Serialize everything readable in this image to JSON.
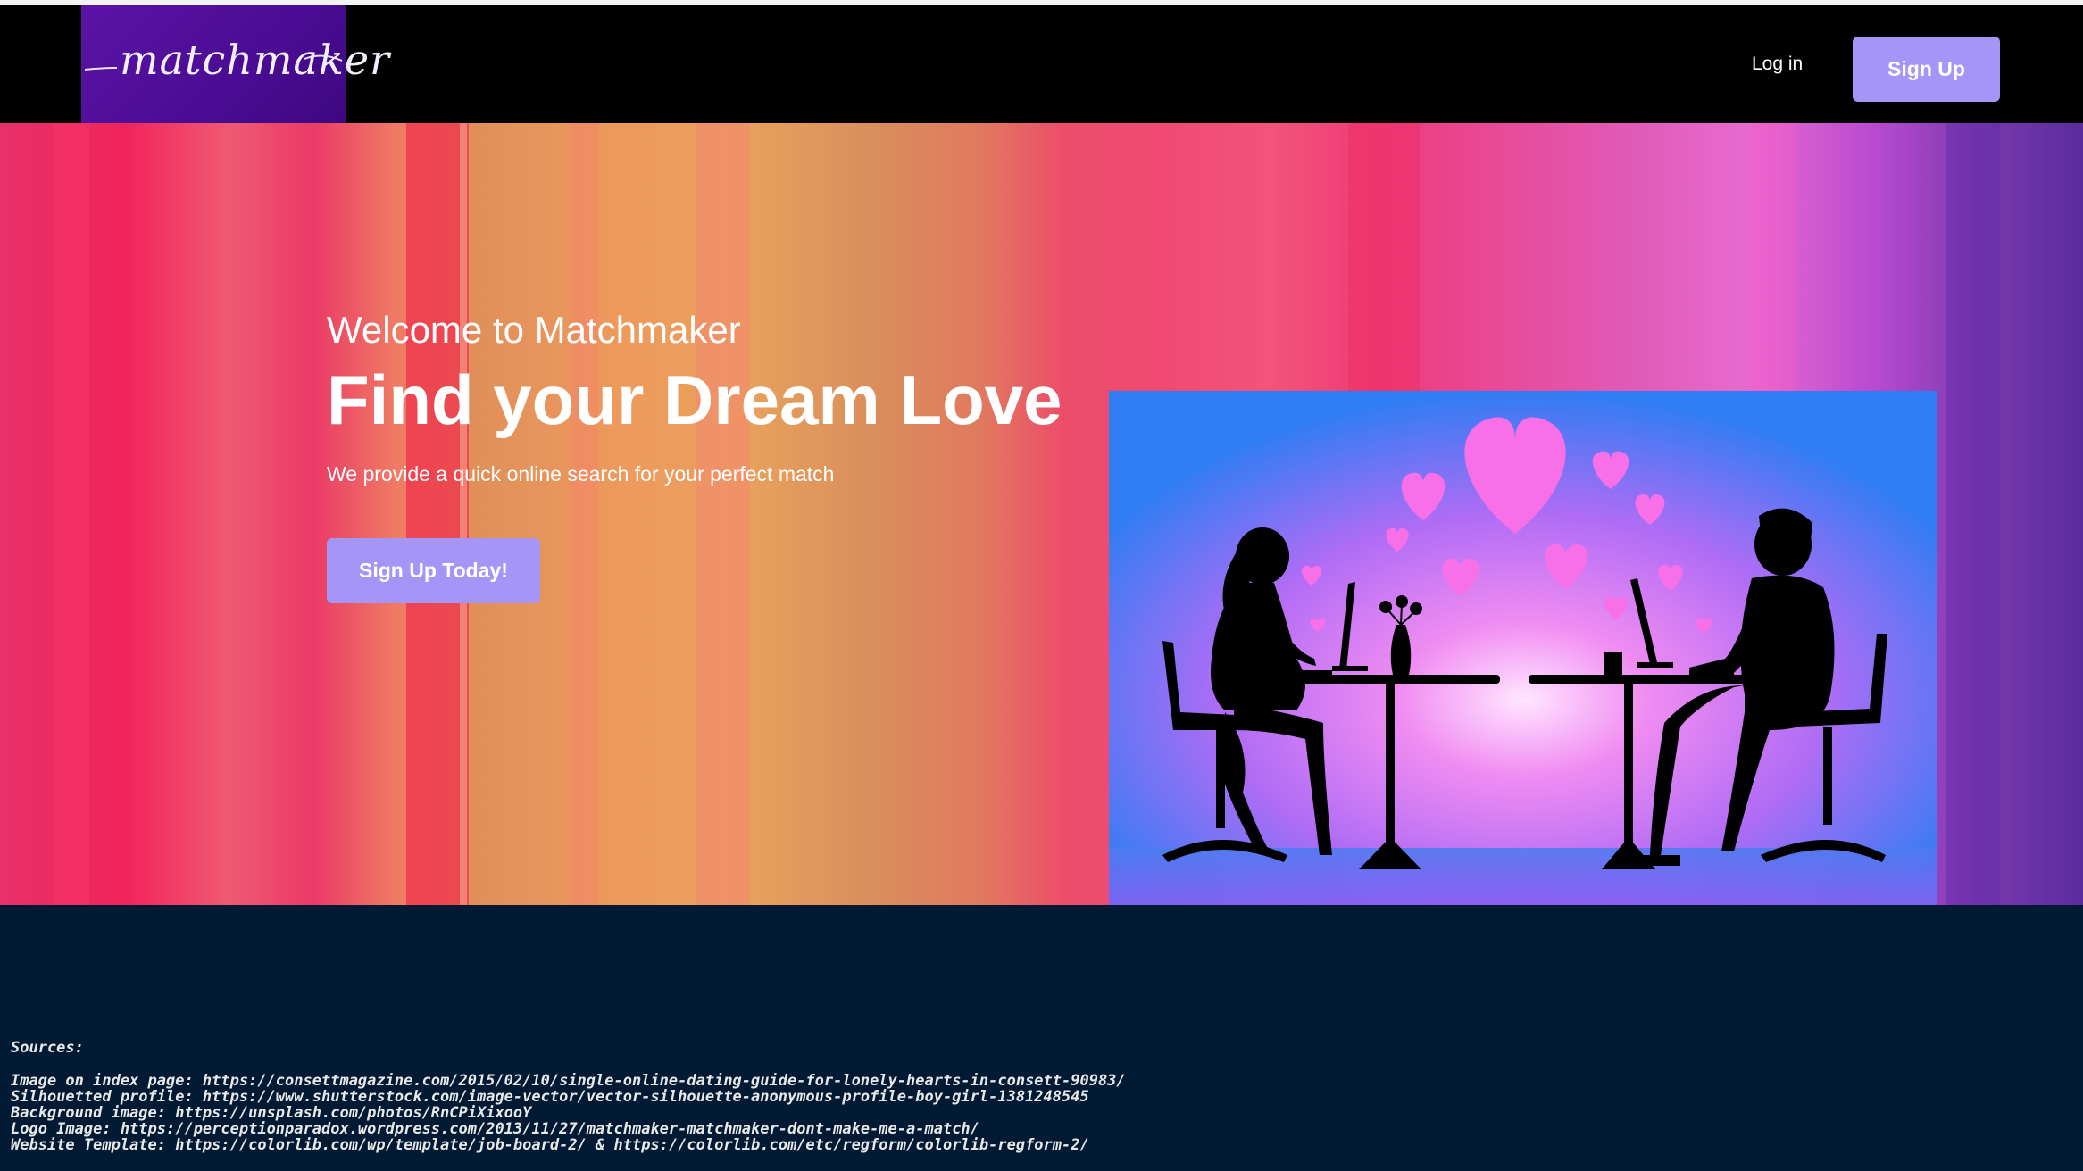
{
  "header": {
    "logo_text": "matchmaker",
    "login_label": "Log in",
    "signup_label": "Sign Up"
  },
  "hero": {
    "welcome": "Welcome to Matchmaker",
    "headline": "Find your Dream Love",
    "tagline": "We provide a quick online search for your perfect match",
    "cta_label": "Sign Up Today!"
  },
  "footer": {
    "sources_title": "Sources:",
    "lines": [
      "Image on index page: https://consettmagazine.com/2015/02/10/single-online-dating-guide-for-lonely-hearts-in-consett-90983/",
      "Silhouetted profile: https://www.shutterstock.com/image-vector/vector-silhouette-anonymous-profile-boy-girl-1381248545",
      "Background image: https://unsplash.com/photos/RnCPiXixooY",
      "Logo Image: https://perceptionparadox.wordpress.com/2013/11/27/matchmaker-matchmaker-dont-make-me-a-match/",
      "Website Template:  https://colorlib.com/wp/template/job-board-2/ & https://colorlib.com/etc/regform/colorlib-regform-2/"
    ]
  },
  "colors": {
    "navbar": "#000000",
    "logo_bg": "#4a0c94",
    "button": "#a495f7",
    "footer": "#001a33"
  }
}
